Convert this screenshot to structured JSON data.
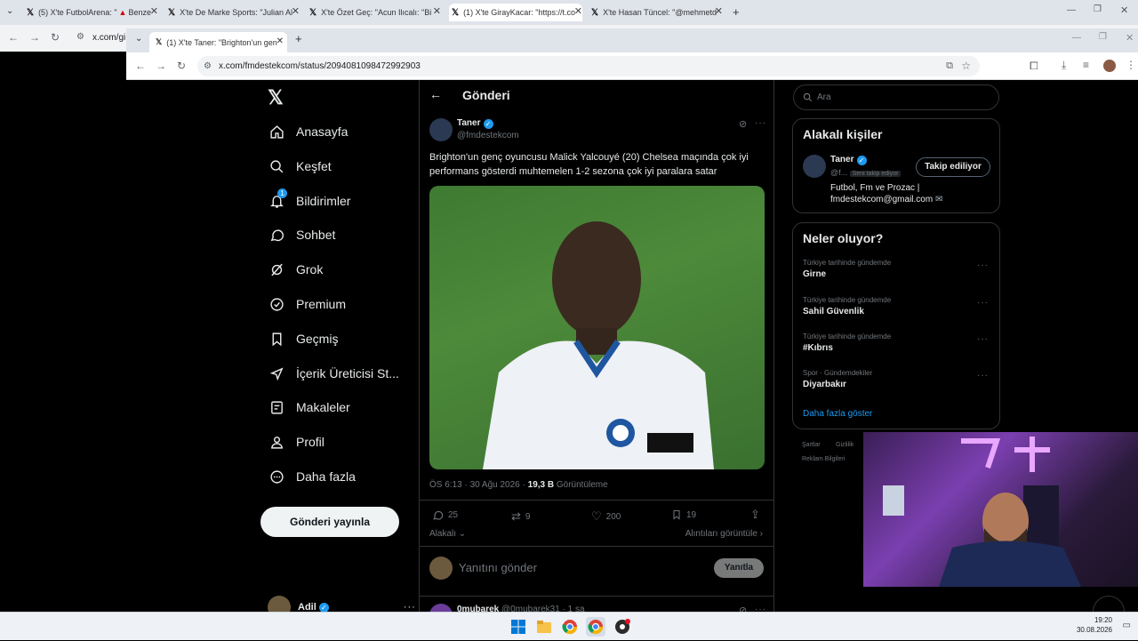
{
  "outer_tabs": [
    {
      "label": "(5) X'te FutbolArena: \"",
      "extra": "Benze"
    },
    {
      "label": "X'te De Marke Sports: \"Julian Al"
    },
    {
      "label": "X'te Özet Geç: \"Acun Ilıcalı: \"Bi"
    },
    {
      "label": "(1) X'te GirayKacar: \"https://t.co"
    },
    {
      "label": "X'te Hasan Tüncel: \"@mehmetd"
    }
  ],
  "outer_url": "x.com/gi",
  "inner_tab": {
    "label": "(1) X'te Taner: \"Brighton'un gen"
  },
  "inner_url": "x.com/fmdestekcom/status/2094081098472992903",
  "nav": {
    "items": [
      {
        "label": "Anasayfa",
        "icon": "home-icon"
      },
      {
        "label": "Keşfet",
        "icon": "search-icon"
      },
      {
        "label": "Bildirimler",
        "icon": "bell-icon",
        "badge": "1"
      },
      {
        "label": "Sohbet",
        "icon": "chat-icon"
      },
      {
        "label": "Grok",
        "icon": "grok-icon"
      },
      {
        "label": "Premium",
        "icon": "premium-icon"
      },
      {
        "label": "Geçmiş",
        "icon": "bookmark-icon"
      },
      {
        "label": "İçerik Üreticisi St...",
        "icon": "rocket-icon"
      },
      {
        "label": "Makaleler",
        "icon": "article-icon"
      },
      {
        "label": "Profil",
        "icon": "person-icon"
      },
      {
        "label": "Daha fazla",
        "icon": "more-circle-icon"
      }
    ],
    "post_button": "Gönderi yayınla",
    "account": {
      "name": "Adil"
    }
  },
  "post": {
    "header_title": "Gönderi",
    "author": "Taner",
    "handle": "@fmdestekcom",
    "text": "Brighton'un genç oyuncusu Malick Yalcouyé (20) Chelsea maçında çok iyi performans gösterdi muhtemelen 1-2 sezona çok iyi paralara satar",
    "time": "ÖS 6:13 · 30 Ağu 2026 · ",
    "views": "19,3 B",
    "views_label": " Görüntüleme",
    "replies": "25",
    "reposts": "9",
    "likes": "200",
    "bookmarks": "19",
    "relevance": "Alakalı",
    "quotes_link": "Alıntıları görüntüle",
    "reply_placeholder": "Yanıtını gönder",
    "reply_button": "Yanıtla",
    "next_reply_name": "0mubarek",
    "next_reply_handle": "@0mubarek31 · 1 sa"
  },
  "search": {
    "placeholder": "Ara"
  },
  "related": {
    "title": "Alakalı kişiler",
    "name": "Taner",
    "handle": "@f...",
    "follows_you": "Seni takip ediyor",
    "follow_button": "Takip ediliyor",
    "bio_line1": "Futbol, Fm ve Prozac |",
    "bio_line2": "fmdestekcom@gmail.com"
  },
  "trends": {
    "title": "Neler oluyor?",
    "items": [
      {
        "category": "Türkiye tarihinde gündemde",
        "name": "Girne"
      },
      {
        "category": "Türkiye tarihinde gündemde",
        "name": "Sahil Güvenlik"
      },
      {
        "category": "Türkiye tarihinde gündemde",
        "name": "#Kıbrıs"
      },
      {
        "category": "Spor · Gündemdekiler",
        "name": "Diyarbakır"
      }
    ],
    "show_more": "Daha fazla göster"
  },
  "footer_links": [
    "Şartlar",
    "Gizlilik",
    "Reklam Bilgileri"
  ],
  "taskbar": {
    "time": "19:20",
    "date": "30.08.2026"
  },
  "colors": {
    "accent": "#1d9bf0",
    "background": "#000000",
    "border": "#2f3336"
  }
}
